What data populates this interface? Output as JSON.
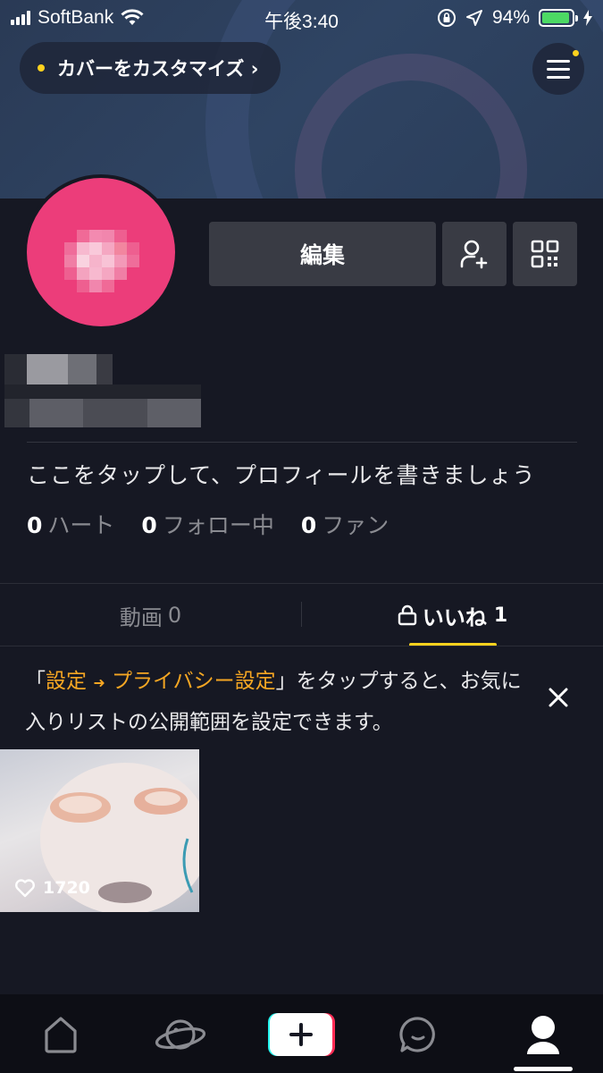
{
  "status_bar": {
    "carrier": "SoftBank",
    "time": "午後3:40",
    "battery_percent": "94%",
    "battery_level": 0.94
  },
  "cover": {
    "customize_label": "カバーをカスタマイズ",
    "customize_chevron": "›"
  },
  "profile": {
    "edit_label": "編集",
    "bio_placeholder": "ここをタップして、プロフィールを書きましょう",
    "stats": [
      {
        "num": "0",
        "label": "ハート"
      },
      {
        "num": "0",
        "label": "フォロー中"
      },
      {
        "num": "0",
        "label": "ファン"
      }
    ]
  },
  "tabs": [
    {
      "label": "動画",
      "count": "0",
      "active": false
    },
    {
      "label": "いいね",
      "count": "1",
      "active": true
    }
  ],
  "notice": {
    "open_quote": "「",
    "settings": "設定",
    "arrow": "➜",
    "privacy": "プライバシー設定",
    "rest": "」をタップすると、お気に入りリストの公開範囲を設定できます。"
  },
  "videos": [
    {
      "likes": "1720"
    }
  ],
  "colors": {
    "background": "#161823",
    "accent_yellow": "#ffd21e",
    "highlight_orange": "#f5a623",
    "avatar_pink": "#ec3d7a",
    "button_gray": "#393b44"
  },
  "icons": {
    "menu": "hamburger-icon",
    "add_friend": "add-user-icon",
    "qr": "qr-code-icon",
    "lock": "lock-icon",
    "close": "close-icon",
    "heart": "heart-icon",
    "nav": [
      "home-icon",
      "discover-planet-icon",
      "create-plus-icon",
      "inbox-chat-icon",
      "profile-icon"
    ]
  }
}
